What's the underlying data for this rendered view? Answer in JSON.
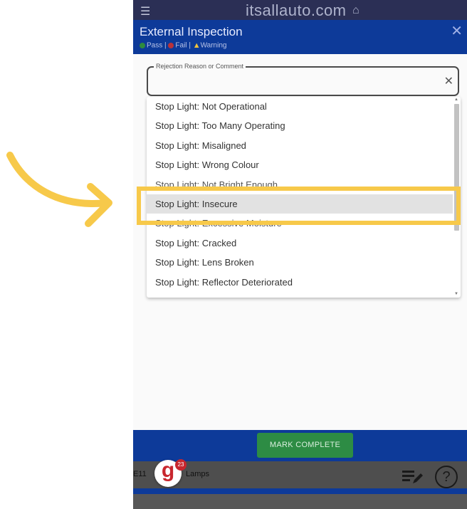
{
  "topbar": {
    "brand": "itsallauto.com",
    "menu_icon": "menu-icon",
    "home_icon": "home-icon"
  },
  "modal": {
    "title": "External Inspection",
    "legend": {
      "pass": "Pass",
      "fail": "Fail",
      "warning": "Warning",
      "separator": "|"
    },
    "close_icon": "close-icon"
  },
  "field": {
    "label": "Rejection Reason or Comment",
    "value": ""
  },
  "dropdown": {
    "items": [
      "Stop Light: Not Operational",
      "Stop Light: Too Many Operating",
      "Stop Light: Misaligned",
      "Stop Light: Wrong Colour",
      "Stop Light: Not Bright Enough",
      "Stop Light: Insecure",
      "Stop Light: Excessive Moisture",
      "Stop Light: Cracked",
      "Stop Light: Lens Broken",
      "Stop Light: Reflector Deteriorated"
    ],
    "highlighted_index": 5
  },
  "footer": {
    "mark_complete": "MARK COMPLETE"
  },
  "bottom": {
    "code": "E11",
    "section": "Lamps",
    "badge_count": "23",
    "avatar_letter": "g"
  },
  "colors": {
    "header_blue": "#0d3a99",
    "button_green": "#2d8c44",
    "highlight_yellow": "#f7c94a",
    "pass": "#2e8b3e",
    "fail": "#b8323a",
    "warning": "#f0c33c"
  }
}
